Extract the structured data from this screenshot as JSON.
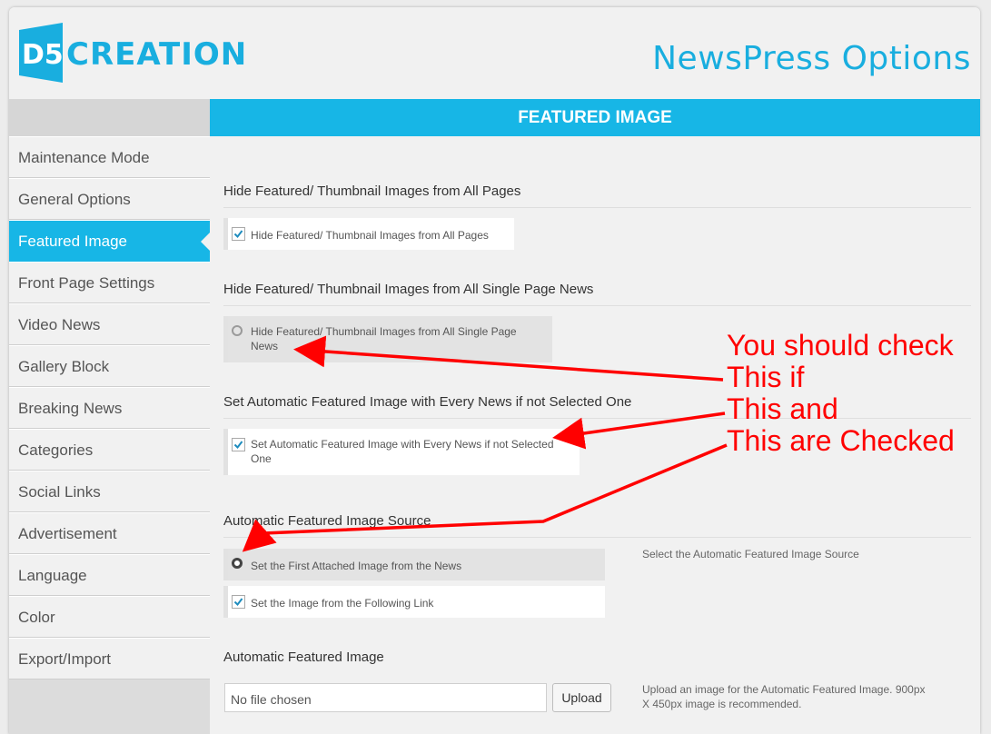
{
  "header": {
    "logo_text": "D5CREATION",
    "title": "NewsPress Options"
  },
  "sidebar": {
    "items": [
      {
        "label": "Maintenance Mode"
      },
      {
        "label": "General Options"
      },
      {
        "label": "Featured Image",
        "active": true
      },
      {
        "label": "Front Page Settings"
      },
      {
        "label": "Video News"
      },
      {
        "label": "Gallery Block"
      },
      {
        "label": "Breaking News"
      },
      {
        "label": "Categories"
      },
      {
        "label": "Social Links"
      },
      {
        "label": "Advertisement"
      },
      {
        "label": "Language"
      },
      {
        "label": "Color"
      },
      {
        "label": "Export/Import"
      }
    ]
  },
  "section": {
    "title": "FEATURED IMAGE"
  },
  "options": {
    "hide_all_pages": {
      "heading": "Hide Featured/ Thumbnail Images from All Pages",
      "label": "Hide Featured/ Thumbnail Images from All Pages",
      "checked": true
    },
    "hide_single_news": {
      "heading": "Hide Featured/ Thumbnail Images from All Single Page News",
      "label_line1": "Hide Featured/ Thumbnail Images from All Single Page",
      "label_line2": "News",
      "checked": false
    },
    "auto_featured": {
      "heading": "Set Automatic Featured Image with Every News if not Selected One",
      "label_line1": "Set Automatic Featured Image with Every News if not Selected",
      "label_line2": "One",
      "checked": true
    },
    "auto_source": {
      "heading": "Automatic Featured Image Source",
      "radio_label": "Set the First Attached Image from the News",
      "checkbox_label": "Set the Image from the Following Link",
      "checkbox_checked": true,
      "help": "Select the Automatic Featured Image Source"
    },
    "auto_image": {
      "heading": "Automatic Featured Image",
      "file_value": "No file chosen",
      "upload_label": "Upload",
      "help_line1": "Upload an image for the Automatic Featured Image. 900px",
      "help_line2": "X 450px image is recommended."
    }
  },
  "annotation": {
    "color": "#ff0000",
    "lines": [
      "You should check",
      "This if",
      "This and",
      "This are Checked"
    ]
  },
  "colors": {
    "accent": "#17b6e6",
    "title": "#19aedf"
  }
}
